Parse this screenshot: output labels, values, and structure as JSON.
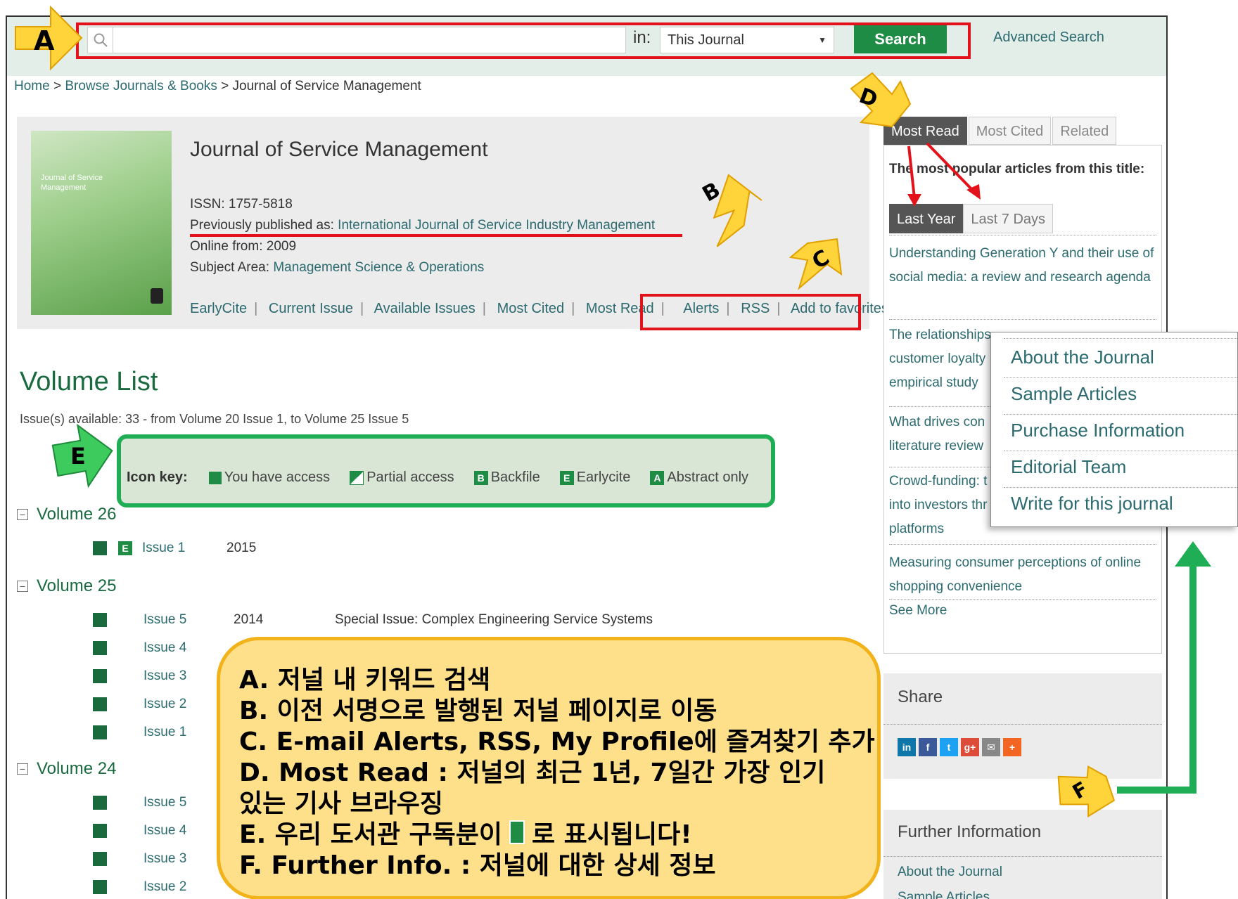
{
  "search": {
    "placeholder": "",
    "in_label": "in:",
    "scope_value": "This Journal",
    "button_label": "Search",
    "advanced_label": "Advanced Search"
  },
  "breadcrumb": {
    "home": "Home",
    "sep": ">",
    "browse": "Browse Journals & Books",
    "current": "Journal of Service Management"
  },
  "journal": {
    "title": "Journal of Service Management",
    "issn": "ISSN: 1757-5818",
    "prev_label": "Previously published as:",
    "prev_link": "International Journal of Service Industry Management",
    "online_from": "Online from: 2009",
    "subject_label": "Subject Area:",
    "subject_link": "Management Science & Operations",
    "cover_text": "Journal of Service Management",
    "nav": [
      "EarlyCite",
      "Current Issue",
      "Available Issues",
      "Most Cited",
      "Most Read",
      "Alerts",
      "RSS",
      "Add to favorites"
    ]
  },
  "volumes": {
    "heading": "Volume List",
    "available": "Issue(s) available: 33 - from Volume 20 Issue 1, to Volume 25 Issue 5",
    "icon_key_label": "Icon key:",
    "icon_key": [
      {
        "letter": "",
        "label": "You have access"
      },
      {
        "letter": "",
        "label": "Partial access"
      },
      {
        "letter": "B",
        "label": "Backfile"
      },
      {
        "letter": "E",
        "label": "Earlycite"
      },
      {
        "letter": "A",
        "label": "Abstract only"
      }
    ],
    "v26": {
      "title": "Volume 26",
      "issues": [
        {
          "issue": "Issue 1",
          "year": "2015",
          "badge": "E"
        }
      ]
    },
    "v25": {
      "title": "Volume 25",
      "issues": [
        {
          "issue": "Issue 5",
          "year": "2014",
          "desc": "Special Issue: Complex Engineering Service Systems"
        },
        {
          "issue": "Issue 4"
        },
        {
          "issue": "Issue 3"
        },
        {
          "issue": "Issue 2"
        },
        {
          "issue": "Issue 1"
        }
      ]
    },
    "v24": {
      "title": "Volume 24",
      "issues": [
        {
          "issue": "Issue 5"
        },
        {
          "issue": "Issue 4"
        },
        {
          "issue": "Issue 3"
        },
        {
          "issue": "Issue 2"
        }
      ]
    },
    "toggle": "−"
  },
  "sidebar": {
    "tabs": [
      "Most Read",
      "Most Cited",
      "Related"
    ],
    "popular_head": "The most popular articles from this title:",
    "subtabs": [
      "Last Year",
      "Last 7 Days"
    ],
    "articles": [
      "Understanding Generation Y and their use of social media: a review and research agenda",
      "The relationships customer loyalty empirical study",
      "What drives con literature review",
      "Crowd-funding: t into investors thr platforms",
      "Measuring consumer perceptions of online shopping convenience"
    ],
    "see_more": "See More",
    "share_label": "Share",
    "share_icons": [
      "in",
      "f",
      "t",
      "g+",
      "✉",
      "+"
    ],
    "further_label": "Further Information",
    "further_links": [
      "About the Journal",
      "Sample Articles"
    ]
  },
  "popup": {
    "items": [
      "About the Journal",
      "Sample Articles",
      "Purchase Information",
      "Editorial Team",
      "Write for this journal"
    ]
  },
  "annotations": {
    "labels": [
      "A",
      "B",
      "C",
      "D",
      "E",
      "F"
    ]
  },
  "callout": {
    "lines": [
      "A. 저널 내 키워드 검색",
      "B. 이전 서명으로 발행된 저널 페이지로 이동",
      "C. E-mail Alerts, RSS, My Profile에 즐겨찾기 추가",
      "D. Most Read : 저널의 최근 1년, 7일간 가장 인기",
      "있는 기사 브라우징",
      "E. 우리 도서관 구독분이",
      "로  표시됩니다!",
      "F. Further Info. : 저널에 대한 상세 정보"
    ]
  },
  "colors": {
    "accent_green": "#1e8c45",
    "highlight_red": "#e3121a",
    "callout_fill": "#ffe08a",
    "arrow_yellow": "#ffd43b",
    "arrow_green": "#1fae55"
  }
}
